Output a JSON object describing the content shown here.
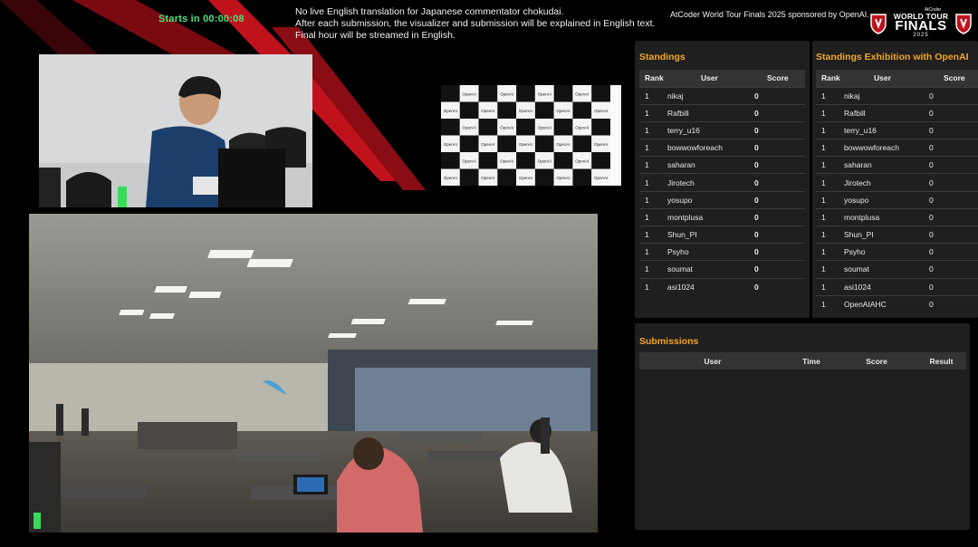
{
  "timer": "Starts in 00:00:08",
  "notice_lines": [
    "No live English translation for Japanese commentator chokudai.",
    "After each submission, the visualizer and submission will be explained in English text.",
    "Final hour will be streamed in English."
  ],
  "sponsor": "AtCoder World Tour Finals 2025 sponsored by OpenAI.",
  "logo": {
    "sub": "AtCoder",
    "line1": "WORLD TOUR",
    "line2": "FINALS",
    "year": "2025"
  },
  "colors": {
    "accent": "#f5a623",
    "timer": "#4ae37c",
    "panel": "#1f1f1f",
    "score_dot": "#f5c400"
  },
  "standings": {
    "title": "Standings",
    "headers": [
      "Rank",
      "User",
      "Score"
    ],
    "rows": [
      [
        "1",
        "nikaj",
        "0"
      ],
      [
        "1",
        "Rafbill",
        "0"
      ],
      [
        "1",
        "terry_u16",
        "0"
      ],
      [
        "1",
        "bowwowforeach",
        "0"
      ],
      [
        "1",
        "saharan",
        "0"
      ],
      [
        "1",
        "Jirotech",
        "0"
      ],
      [
        "1",
        "yosupo",
        "0"
      ],
      [
        "1",
        "montplusa",
        "0"
      ],
      [
        "1",
        "Shun_PI",
        "0"
      ],
      [
        "1",
        "Psyho",
        "0"
      ],
      [
        "1",
        "soumat",
        "0"
      ],
      [
        "1",
        "asi1024",
        "0"
      ]
    ]
  },
  "exhibition": {
    "title": "Standings Exhibition with OpenAI",
    "headers": [
      "Rank",
      "User",
      "Score"
    ],
    "rows": [
      [
        "1",
        "nikaj",
        "0"
      ],
      [
        "1",
        "Rafbill",
        "0"
      ],
      [
        "1",
        "terry_u16",
        "0"
      ],
      [
        "1",
        "bowwowforeach",
        "0"
      ],
      [
        "1",
        "saharan",
        "0"
      ],
      [
        "1",
        "Jirotech",
        "0"
      ],
      [
        "1",
        "yosupo",
        "0"
      ],
      [
        "1",
        "montplusa",
        "0"
      ],
      [
        "1",
        "Shun_PI",
        "0"
      ],
      [
        "1",
        "Psyho",
        "0"
      ],
      [
        "1",
        "soumat",
        "0"
      ],
      [
        "1",
        "asi1024",
        "0"
      ],
      [
        "1",
        "OpenAIAHC",
        "0"
      ]
    ]
  },
  "submissions": {
    "title": "Submissions",
    "headers": [
      "User",
      "Time",
      "Score",
      "Result"
    ]
  },
  "backdrop_text": [
    "OpenAI",
    "AtCoder"
  ]
}
